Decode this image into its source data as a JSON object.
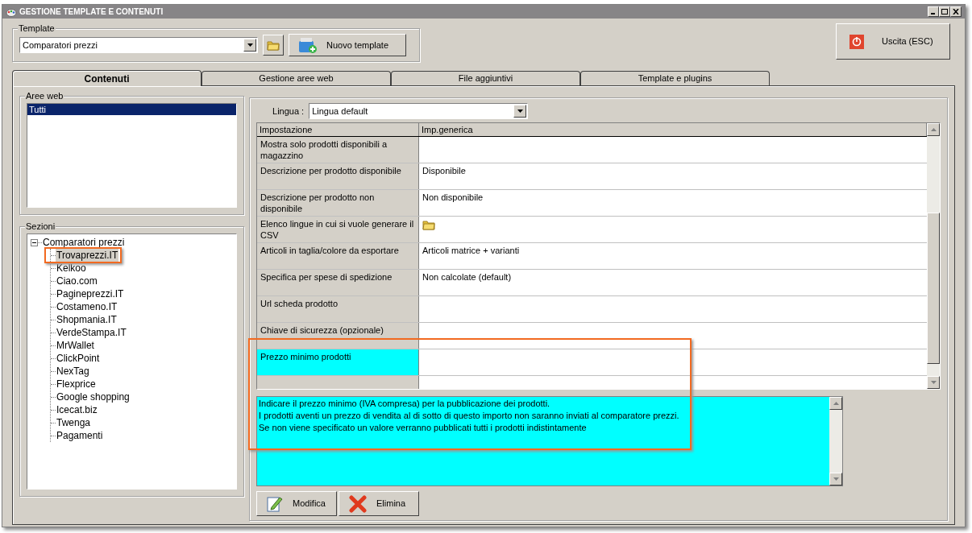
{
  "window": {
    "title": "GESTIONE TEMPLATE E CONTENUTI"
  },
  "template": {
    "label": "Template",
    "value": "Comparatori prezzi",
    "new_button": "Nuovo template"
  },
  "exit_button": "Uscita (ESC)",
  "tabs": [
    {
      "label": "Contenuti",
      "selected": true
    },
    {
      "label": "Gestione aree web",
      "selected": false
    },
    {
      "label": "File aggiuntivi",
      "selected": false
    },
    {
      "label": "Template e plugins",
      "selected": false
    }
  ],
  "web_areas": {
    "label": "Aree web",
    "items": [
      {
        "label": "Tutti",
        "selected": true
      }
    ]
  },
  "sections": {
    "label": "Sezioni",
    "tree": [
      {
        "label": "Comparatori prezzi",
        "expanded": true,
        "selected": false,
        "children": [
          {
            "label": "Trovaprezzi.IT",
            "selected": true
          },
          {
            "label": "Kelkoo",
            "selected": false
          },
          {
            "label": "Ciao.com",
            "selected": false
          },
          {
            "label": "Pagineprezzi.IT",
            "selected": false
          },
          {
            "label": "Costameno.IT",
            "selected": false
          },
          {
            "label": "Shopmania.IT",
            "selected": false
          },
          {
            "label": "VerdeStampa.IT",
            "selected": false
          },
          {
            "label": "MrWallet",
            "selected": false
          },
          {
            "label": "ClickPoint",
            "selected": false
          },
          {
            "label": "NexTag",
            "selected": false
          },
          {
            "label": "Flexprice",
            "selected": false
          },
          {
            "label": "Google shopping",
            "selected": false
          },
          {
            "label": "Icecat.biz",
            "selected": false
          },
          {
            "label": "Twenga",
            "selected": false
          },
          {
            "label": "Pagamenti",
            "selected": false
          }
        ]
      }
    ]
  },
  "language": {
    "label": "Lingua :",
    "value": "Lingua default"
  },
  "settings_table": {
    "columns": [
      "Impostazione",
      "Imp.generica"
    ],
    "rows": [
      {
        "setting": "Mostra solo prodotti disponibili a magazzino",
        "kind": "text",
        "selected": false
      },
      {
        "setting": "Descrizione per prodotto disponibile",
        "kind": "text",
        "value": "Disponibile",
        "selected": false
      },
      {
        "setting": "Descrizione per prodotto non disponibile",
        "kind": "text",
        "value": "Non disponibile",
        "selected": false
      },
      {
        "setting": "Elenco lingue in cui si vuole generare il CSV",
        "kind": "icon",
        "selected": false
      },
      {
        "setting": "Articoli in taglia/colore da esportare",
        "kind": "text",
        "value": "Articoli matrice + varianti",
        "selected": false
      },
      {
        "setting": "Specifica per spese di spedizione",
        "kind": "text",
        "value": "Non calcolate (default)",
        "selected": false
      },
      {
        "setting": "Url scheda prodotto",
        "kind": "text",
        "selected": false
      },
      {
        "setting": "Chiave di sicurezza (opzionale)",
        "kind": "text",
        "selected": false
      },
      {
        "setting": "Prezzo minimo prodotti",
        "kind": "text",
        "selected": true
      }
    ]
  },
  "description": {
    "lines": [
      "Indicare il prezzo minimo (IVA compresa) per la pubblicazione dei prodotti.",
      "I prodotti aventi un prezzo di vendita al di sotto di questo importo non saranno inviati al comparatore prezzi.",
      "Se non viene specificato un valore verranno pubblicati tutti i prodotti indistintamente"
    ]
  },
  "buttons": [
    {
      "label": "Modifica",
      "kind": "edit"
    },
    {
      "label": "Elimina",
      "kind": "delete"
    }
  ]
}
